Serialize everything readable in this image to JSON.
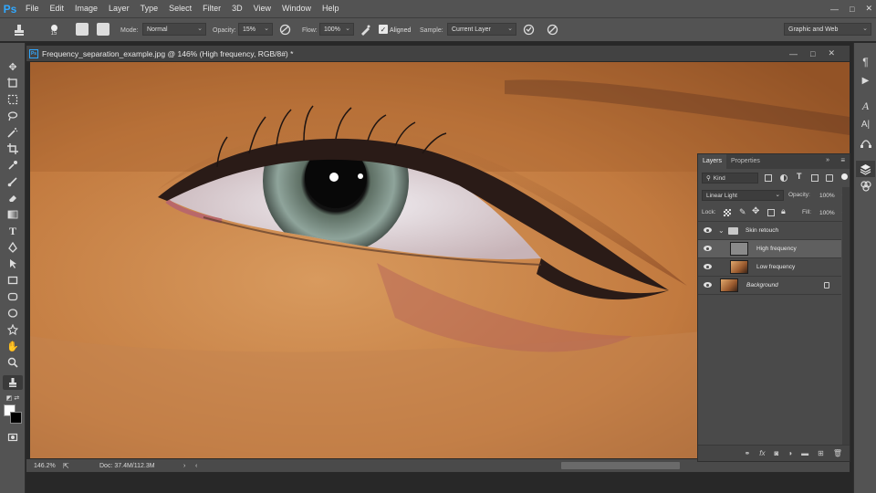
{
  "app": {
    "logo": "Ps",
    "menu": [
      "File",
      "Edit",
      "Image",
      "Layer",
      "Type",
      "Select",
      "Filter",
      "3D",
      "View",
      "Window",
      "Help"
    ],
    "window_controls": [
      "—",
      "□",
      "✕"
    ]
  },
  "options_bar": {
    "brush_size": "15",
    "mode_label": "Mode:",
    "mode_value": "Normal",
    "opacity_label": "Opacity:",
    "opacity_value": "15%",
    "flow_label": "Flow:",
    "flow_value": "100%",
    "aligned_label": "Aligned",
    "aligned_checked": true,
    "sample_label": "Sample:",
    "sample_value": "Current Layer",
    "workspace": "Graphic and Web"
  },
  "document": {
    "tab_title": "Frequency_separation_example.jpg @ 146% (High frequency, RGB/8#) *",
    "zoom": "146.2%",
    "doc_info": "Doc: 37.4M/112.3M"
  },
  "layers_panel": {
    "tabs": [
      "Layers",
      "Properties"
    ],
    "filter_kind": "Kind",
    "blend_mode": "Linear Light",
    "opacity_label": "Opacity:",
    "opacity_value": "100%",
    "lock_label": "Lock:",
    "fill_label": "Fill:",
    "fill_value": "100%",
    "layers": [
      {
        "name": "Skin retouch",
        "type": "group"
      },
      {
        "name": "High frequency",
        "type": "layer",
        "selected": true
      },
      {
        "name": "Low frequency",
        "type": "layer"
      },
      {
        "name": "Background",
        "type": "background",
        "locked": true
      }
    ],
    "footer_fx": "fx"
  },
  "colors": {
    "chrome": "#535353",
    "accent": "#31a8ff",
    "selected_layer": "#5f5f5f"
  }
}
